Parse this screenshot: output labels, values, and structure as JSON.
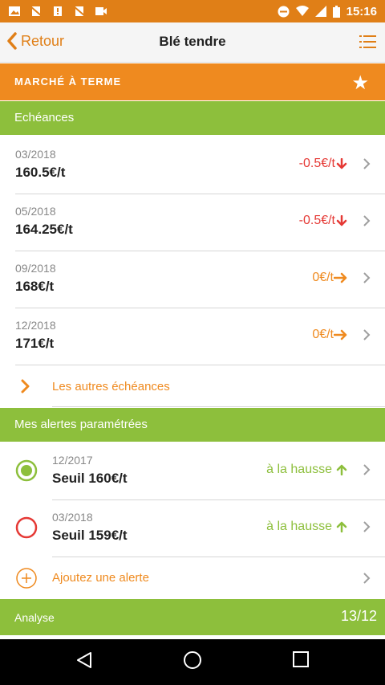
{
  "status_bar": {
    "time": "15:16",
    "icons": [
      "image-icon",
      "no-sim-icon",
      "sim-error-icon",
      "no-sim-icon",
      "video-icon"
    ],
    "right_icons": [
      "do-not-disturb-icon",
      "wifi-icon",
      "signal-icon",
      "battery-icon"
    ]
  },
  "app_bar": {
    "back_label": "Retour",
    "title": "Blé tendre",
    "menu_icon": "list-menu-icon"
  },
  "market_section": {
    "label": "MARCHÉ À TERME",
    "icon": "star-icon"
  },
  "echeances": {
    "header": "Echéances",
    "rows": [
      {
        "date": "03/2018",
        "price": "160.5€/t",
        "change": "-0.5€/t",
        "trend": "down"
      },
      {
        "date": "05/2018",
        "price": "164.25€/t",
        "change": "-0.5€/t",
        "trend": "down"
      },
      {
        "date": "09/2018",
        "price": "168€/t",
        "change": "0€/t",
        "trend": "flat"
      },
      {
        "date": "12/2018",
        "price": "171€/t",
        "change": "0€/t",
        "trend": "flat"
      }
    ],
    "more_label": "Les autres échéances"
  },
  "alerts": {
    "header": "Mes alertes paramétrées",
    "rows": [
      {
        "date": "12/2017",
        "threshold": "Seuil 160€/t",
        "direction": "à la hausse",
        "active": true
      },
      {
        "date": "03/2018",
        "threshold": "Seuil 159€/t",
        "direction": "à la hausse",
        "active": false
      }
    ],
    "add_label": "Ajoutez une alerte"
  },
  "analyse": {
    "label": "Analyse",
    "count": "13/12"
  },
  "colors": {
    "orange": "#ef8a1f",
    "green": "#8dbf3c",
    "red": "#e53935",
    "status_bar": "#e07f17"
  }
}
